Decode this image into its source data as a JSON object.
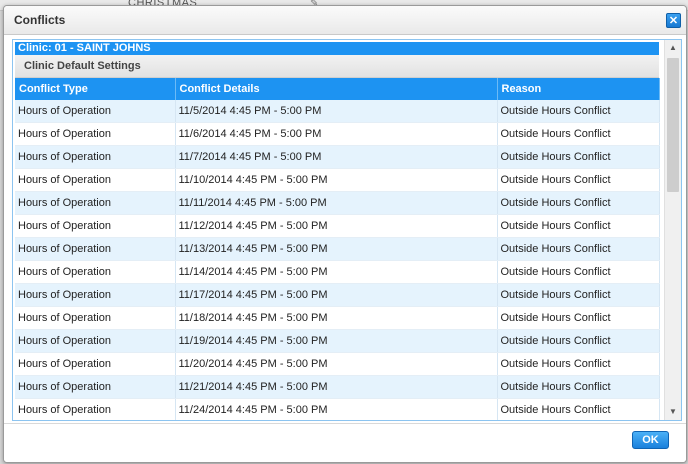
{
  "background": {
    "label": "CHRISTMAS",
    "edit_icon": "pencil-icon"
  },
  "dialog": {
    "title": "Conflicts",
    "close_icon": "close-icon",
    "clinic_label": "Clinic: 01 - SAINT JOHNS",
    "section_label": "Clinic Default Settings",
    "columns": [
      "Conflict Type",
      "Conflict Details",
      "Reason"
    ],
    "rows": [
      [
        "Hours of Operation",
        "11/5/2014 4:45 PM - 5:00 PM",
        "Outside Hours Conflict"
      ],
      [
        "Hours of Operation",
        "11/6/2014 4:45 PM - 5:00 PM",
        "Outside Hours Conflict"
      ],
      [
        "Hours of Operation",
        "11/7/2014 4:45 PM - 5:00 PM",
        "Outside Hours Conflict"
      ],
      [
        "Hours of Operation",
        "11/10/2014 4:45 PM - 5:00 PM",
        "Outside Hours Conflict"
      ],
      [
        "Hours of Operation",
        "11/11/2014 4:45 PM - 5:00 PM",
        "Outside Hours Conflict"
      ],
      [
        "Hours of Operation",
        "11/12/2014 4:45 PM - 5:00 PM",
        "Outside Hours Conflict"
      ],
      [
        "Hours of Operation",
        "11/13/2014 4:45 PM - 5:00 PM",
        "Outside Hours Conflict"
      ],
      [
        "Hours of Operation",
        "11/14/2014 4:45 PM - 5:00 PM",
        "Outside Hours Conflict"
      ],
      [
        "Hours of Operation",
        "11/17/2014 4:45 PM - 5:00 PM",
        "Outside Hours Conflict"
      ],
      [
        "Hours of Operation",
        "11/18/2014 4:45 PM - 5:00 PM",
        "Outside Hours Conflict"
      ],
      [
        "Hours of Operation",
        "11/19/2014 4:45 PM - 5:00 PM",
        "Outside Hours Conflict"
      ],
      [
        "Hours of Operation",
        "11/20/2014 4:45 PM - 5:00 PM",
        "Outside Hours Conflict"
      ],
      [
        "Hours of Operation",
        "11/21/2014 4:45 PM - 5:00 PM",
        "Outside Hours Conflict"
      ],
      [
        "Hours of Operation",
        "11/24/2014 4:45 PM - 5:00 PM",
        "Outside Hours Conflict"
      ]
    ],
    "ok_label": "OK"
  },
  "colors": {
    "accent": "#1d93f2",
    "row_alt": "#e5f3fd"
  }
}
